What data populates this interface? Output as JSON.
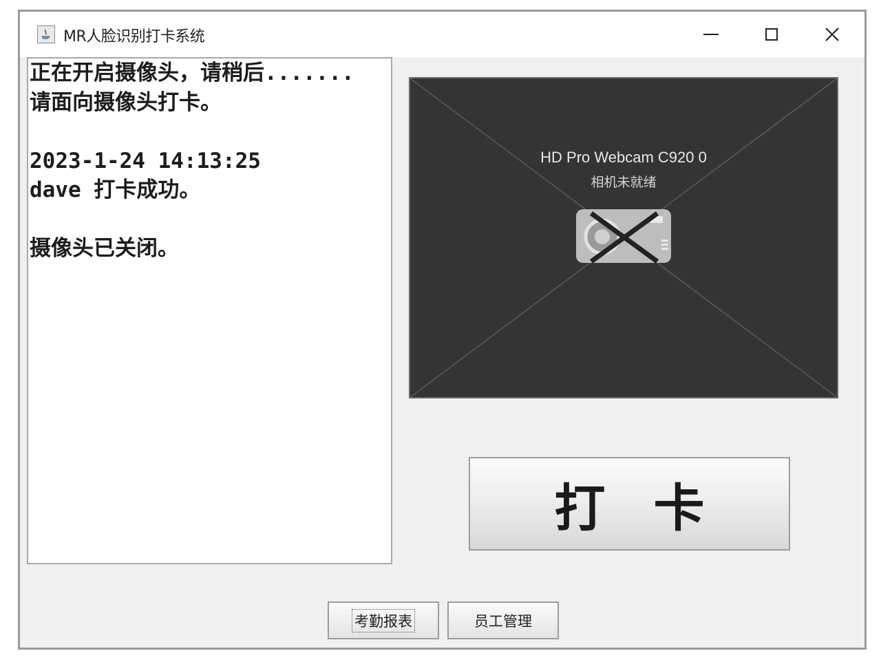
{
  "window": {
    "title": "MR人脸识别打卡系统",
    "icon": "java-app-icon",
    "controls": {
      "minimize": "minimize-icon",
      "maximize": "maximize-icon",
      "close": "close-icon"
    },
    "close_glyph": "✕"
  },
  "log": {
    "lines": [
      "正在开启摄像头，请稍后.......",
      "请面向摄像头打卡。",
      "",
      "2023-1-24 14:13:25",
      "dave 打卡成功。",
      "",
      "摄像头已关闭。"
    ]
  },
  "camera": {
    "device_name": "HD Pro Webcam C920 0",
    "status": "相机未就绪",
    "icon": "camera-unavailable-icon"
  },
  "punch_button": {
    "label": "打卡"
  },
  "buttons": {
    "report": "考勤报表",
    "staff": "员工管理"
  }
}
